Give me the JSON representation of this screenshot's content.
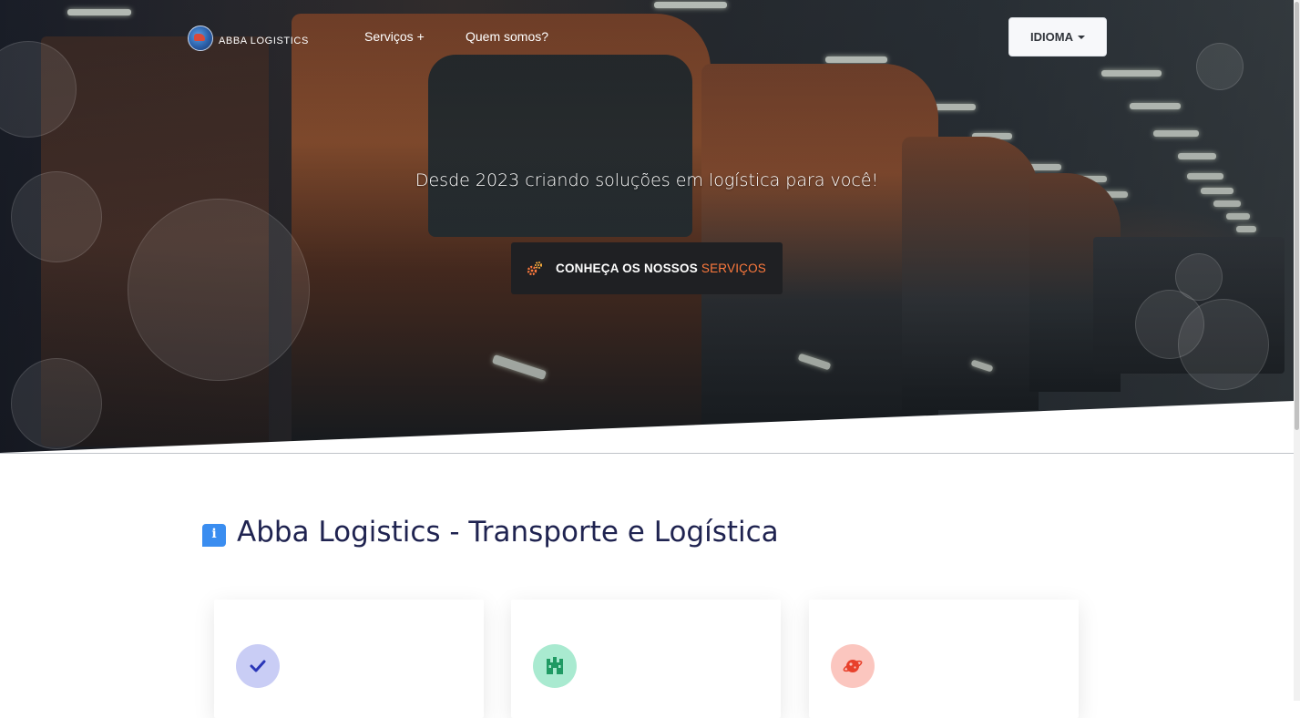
{
  "navbar": {
    "brand": "ABBA LOGISTICS",
    "links": [
      {
        "label": "Serviços +"
      },
      {
        "label": "Quem somos?"
      }
    ],
    "language_button": "IDIOMA"
  },
  "hero": {
    "tagline": "Desde 2023 criando soluções em logística para você!",
    "cta": {
      "label": "CONHEÇA OS NOSSOS",
      "accent": "SERVIÇOS"
    }
  },
  "section": {
    "title": "Abba Logistics - Transporte e Logística",
    "info_icon_glyph": "i"
  },
  "cards": [
    {
      "icon": "check-icon",
      "color": "#c9cdf5"
    },
    {
      "icon": "building-icon",
      "color": "#a9ead0"
    },
    {
      "icon": "globe-icon",
      "color": "#fbc6bf"
    }
  ],
  "colors": {
    "accent": "#ff7a3d",
    "title": "#1f2350",
    "info_icon": "#3a8df0"
  }
}
